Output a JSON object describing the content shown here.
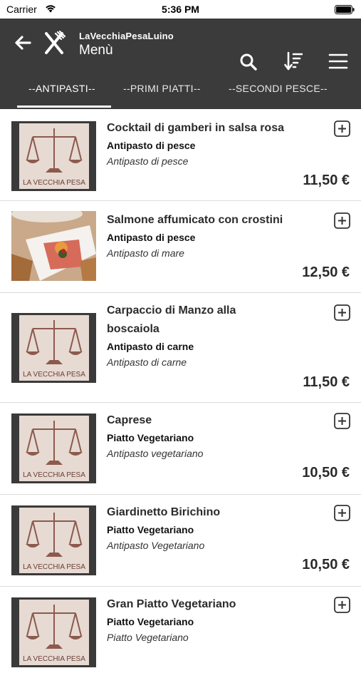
{
  "status_bar": {
    "carrier": "Carrier",
    "time": "5:36 PM"
  },
  "header": {
    "subtitle": "LaVecchiaPesaLuino",
    "title": "Menù",
    "background": "#3b3b3b"
  },
  "tabs": [
    {
      "label": "--ANTIPASTI--",
      "selected": true
    },
    {
      "label": "--PRIMI PIATTI--",
      "selected": false
    },
    {
      "label": "--SECONDI PESCE--",
      "selected": false
    }
  ],
  "items": [
    {
      "name": "Cocktail di gamberi in salsa rosa",
      "category": "Antipasto di pesce",
      "description": "Antipasto di pesce",
      "price": "11,50 €",
      "image": "logo-scale"
    },
    {
      "name": "Salmone affumicato con crostini",
      "category": "Antipasto di pesce",
      "description": "Antipasto di mare",
      "price": "12,50 €",
      "image": "food-photo"
    },
    {
      "name": "Carpaccio di Manzo alla boscaiola",
      "category": "Antipasto di carne",
      "description": "Antipasto di carne",
      "price": "11,50 €",
      "image": "logo-scale"
    },
    {
      "name": "Caprese",
      "category": "Piatto Vegetariano",
      "description": "Antipasto vegetariano",
      "price": "10,50 €",
      "image": "logo-scale"
    },
    {
      "name": "Giardinetto Birichino",
      "category": "Piatto Vegetariano",
      "description": "Antipasto Vegetariano",
      "price": "10,50 €",
      "image": "logo-scale"
    },
    {
      "name": "Gran Piatto Vegetariano",
      "category": "Piatto Vegetariano",
      "description": "Piatto Vegetariano",
      "price": "",
      "image": "logo-scale"
    }
  ],
  "logo_text": "LA VECCHIA PESA"
}
